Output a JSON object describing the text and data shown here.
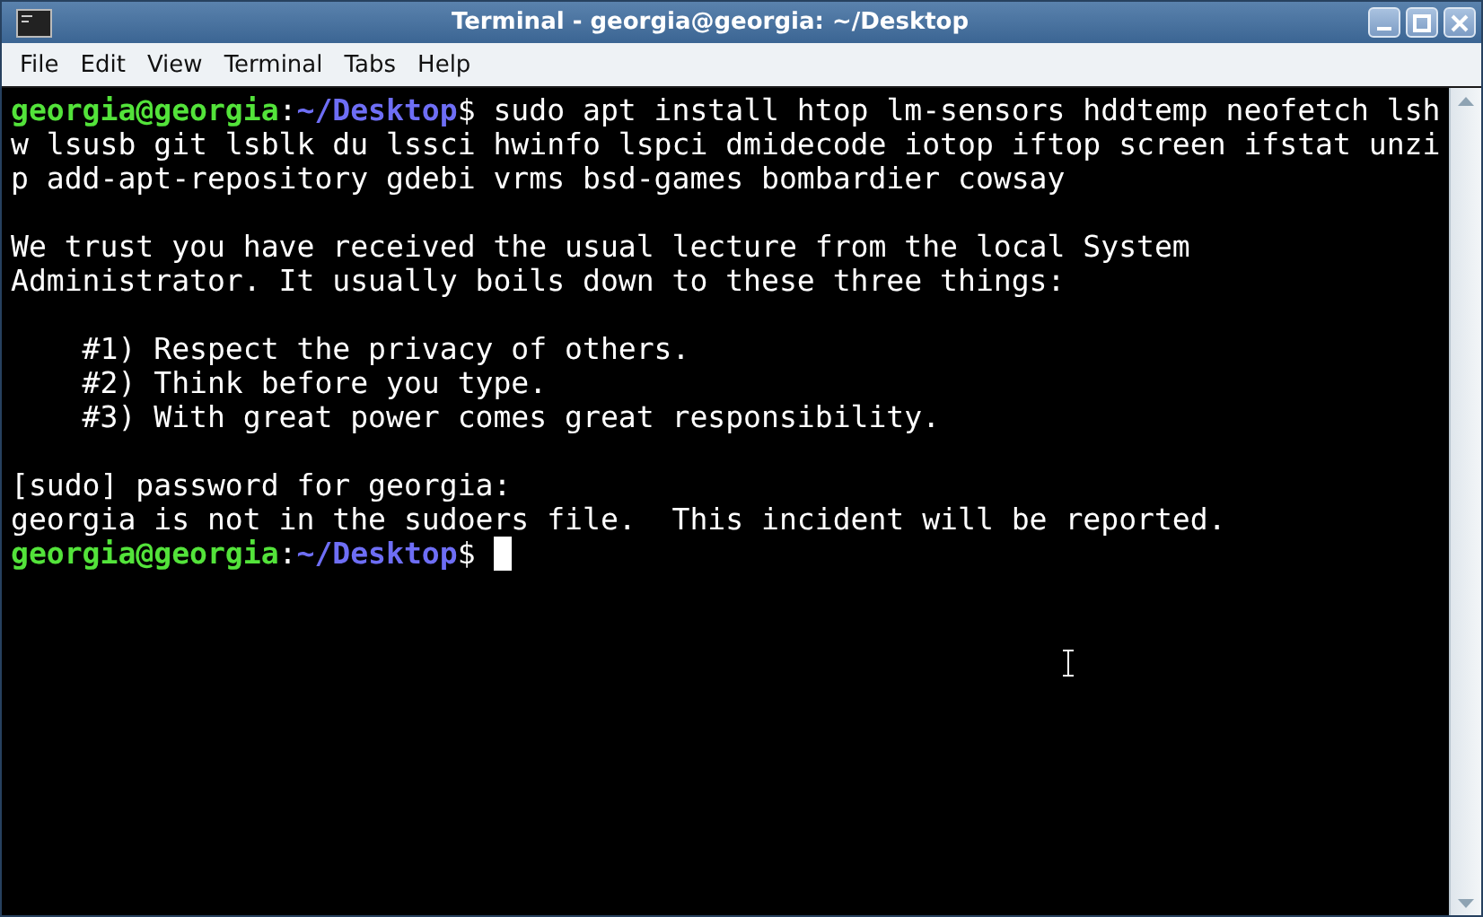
{
  "window": {
    "title": "Terminal - georgia@georgia: ~/Desktop"
  },
  "menu": [
    "File",
    "Edit",
    "View",
    "Terminal",
    "Tabs",
    "Help"
  ],
  "terminal": {
    "lines": [
      {
        "kind": "prompt",
        "user": "georgia@georgia",
        "separator": ":",
        "path": "~/Desktop",
        "command": "$ sudo apt install htop lm-sensors hddtemp neofetch lsh",
        "cursor": false
      },
      {
        "kind": "output",
        "text": "w lsusb git lsblk du lssci hwinfo lspci dmidecode iotop iftop screen ifstat unzi"
      },
      {
        "kind": "output",
        "text": "p add-apt-repository gdebi vrms bsd-games bombardier cowsay"
      },
      {
        "kind": "blank"
      },
      {
        "kind": "output",
        "text": "We trust you have received the usual lecture from the local System"
      },
      {
        "kind": "output",
        "text": "Administrator. It usually boils down to these three things:"
      },
      {
        "kind": "blank"
      },
      {
        "kind": "output",
        "text": "    #1) Respect the privacy of others."
      },
      {
        "kind": "output",
        "text": "    #2) Think before you type."
      },
      {
        "kind": "output",
        "text": "    #3) With great power comes great responsibility."
      },
      {
        "kind": "blank"
      },
      {
        "kind": "output",
        "text": "[sudo] password for georgia:"
      },
      {
        "kind": "output",
        "text": "georgia is not in the sudoers file.  This incident will be reported."
      },
      {
        "kind": "prompt",
        "user": "georgia@georgia",
        "separator": ":",
        "path": "~/Desktop",
        "command": "$",
        "cursor": true
      }
    ]
  }
}
